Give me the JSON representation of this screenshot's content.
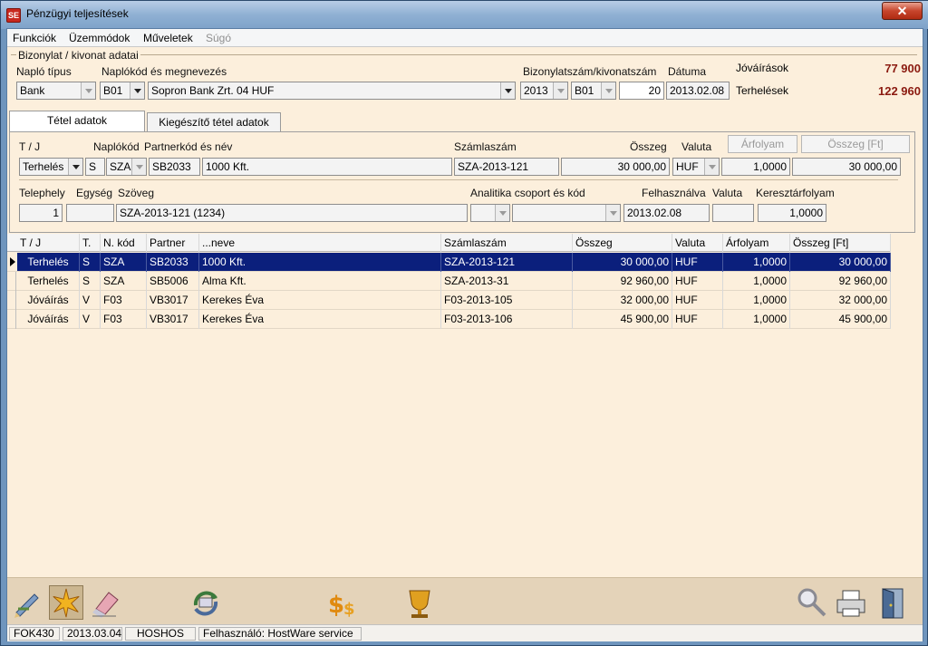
{
  "window": {
    "title": "Pénzügyi teljesítések",
    "icon": "app-logo-icon",
    "close_label": "✕"
  },
  "menu": [
    "Funkciók",
    "Üzemmódok",
    "Műveletek",
    "Súgó"
  ],
  "header": {
    "group_title": "Bizonylat / kivonat adatai",
    "naplo_tipus_label": "Napló típus",
    "naplo_tipus_value": "Bank",
    "naplokod_label": "Naplókód és megnevezés",
    "naplokod_value": "B01",
    "naplo_name_value": "Sopron Bank Zrt. 04 HUF",
    "bizonylat_label": "Bizonylatszám/kivonatszám",
    "bizonylat_year": "2013",
    "bizonylat_code": "B01",
    "bizonylat_number": "20",
    "datum_label": "Dátuma",
    "datum_value": "2013.02.08",
    "jovairasok_label": "Jóváírások",
    "jovairasok_value": "77 900",
    "terhelesek_label": "Terhelések",
    "terhelesek_value": "122 960"
  },
  "tabs": [
    "Tétel adatok",
    "Kiegészítő tétel adatok"
  ],
  "detail": {
    "tj_label": "T / J",
    "tj_value": "Terhelés",
    "naplokod_label": "Naplókód",
    "naplokod_s": "S",
    "naplokod_value": "SZA",
    "partner_label": "Partnerkód és név",
    "partner_code": "SB2033",
    "partner_name": "1000 Kft.",
    "szamlaszam_label": "Számlaszám",
    "szamlaszam_value": "SZA-2013-121",
    "osszeg_label": "Összeg",
    "osszeg_value": "30 000,00",
    "valuta_label": "Valuta",
    "valuta_value": "HUF",
    "arfolyam_btn": "Árfolyam",
    "arfolyam_value": "1,0000",
    "osszeg_ft_btn": "Összeg [Ft]",
    "osszeg_ft_value": "30 000,00",
    "telephely_label": "Telephely",
    "telephely_value": "1",
    "egyseg_label": "Egység",
    "egyseg_value": "",
    "szoveg_label": "Szöveg",
    "szoveg_value": "SZA-2013-121 (1234)",
    "analitika_label": "Analitika csoport és kód",
    "felhasznalva_label": "Felhasználva",
    "felhasznalva_value": "2013.02.08",
    "valuta2_label": "Valuta",
    "valuta2_value": "",
    "kereszt_label": "Keresztárfolyam",
    "kereszt_value": "1,0000"
  },
  "table": {
    "columns": [
      "T / J",
      "T.",
      "N. kód",
      "Partner",
      "...neve",
      "Számlaszám",
      "Összeg",
      "Valuta",
      "Árfolyam",
      "Összeg [Ft]"
    ],
    "rows": [
      [
        "Terhelés",
        "S",
        "SZA",
        "SB2033",
        "1000 Kft.",
        "SZA-2013-121",
        "30 000,00",
        "HUF",
        "1,0000",
        "30 000,00"
      ],
      [
        "Terhelés",
        "S",
        "SZA",
        "SB5006",
        "Alma Kft.",
        "SZA-2013-31",
        "92 960,00",
        "HUF",
        "1,0000",
        "92 960,00"
      ],
      [
        "Jóváírás",
        "V",
        "F03",
        "VB3017",
        "Kerekes Éva",
        "F03-2013-105",
        "32 000,00",
        "HUF",
        "1,0000",
        "32 000,00"
      ],
      [
        "Jóváírás",
        "V",
        "F03",
        "VB3017",
        "Kerekes Éva",
        "F03-2013-106",
        "45 900,00",
        "HUF",
        "1,0000",
        "45 900,00"
      ]
    ]
  },
  "toolbar": [
    "edit-pen-icon",
    "star-burst-icon",
    "eraser-icon",
    "refresh-cycle-icon",
    "currency-dollar-icon",
    "trophy-cup-icon",
    "magnifier-icon",
    "printer-icon",
    "exit-door-icon"
  ],
  "status": {
    "code": "FOK430",
    "date": "2013.03.04",
    "host": "HOSHOS",
    "user": "Felhasználó: HostWare service"
  },
  "colors": {
    "selection": "#0b1f7c",
    "totals": "#8b1a10",
    "background": "#fcefdc"
  }
}
